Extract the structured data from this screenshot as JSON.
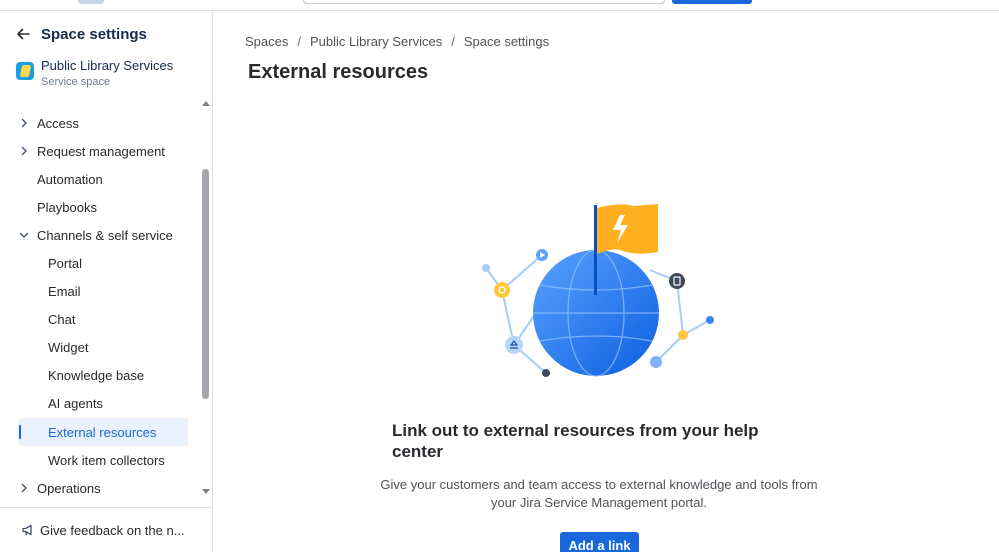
{
  "sidebar": {
    "title": "Space settings",
    "space": {
      "name": "Public Library Services",
      "type": "Service space"
    },
    "items": [
      {
        "label": "Access"
      },
      {
        "label": "Request management"
      },
      {
        "label": "Automation"
      },
      {
        "label": "Playbooks"
      },
      {
        "label": "Channels & self service"
      },
      {
        "label": "Portal"
      },
      {
        "label": "Email"
      },
      {
        "label": "Chat"
      },
      {
        "label": "Widget"
      },
      {
        "label": "Knowledge base"
      },
      {
        "label": "AI agents"
      },
      {
        "label": "External resources"
      },
      {
        "label": "Work item collectors"
      },
      {
        "label": "Operations"
      }
    ],
    "feedback_label": "Give feedback on the n..."
  },
  "breadcrumb": [
    "Spaces",
    "Public Library Services",
    "Space settings"
  ],
  "page_title": "External resources",
  "empty_state": {
    "heading": "Link out to external resources from your help center",
    "description": "Give your customers and team access to external knowledge and tools from your Jira Service Management portal.",
    "button_label": "Add a link"
  },
  "colors": {
    "accent": "#1868db",
    "selected_bg": "#e9f2fe",
    "flag": "#ffb020"
  }
}
